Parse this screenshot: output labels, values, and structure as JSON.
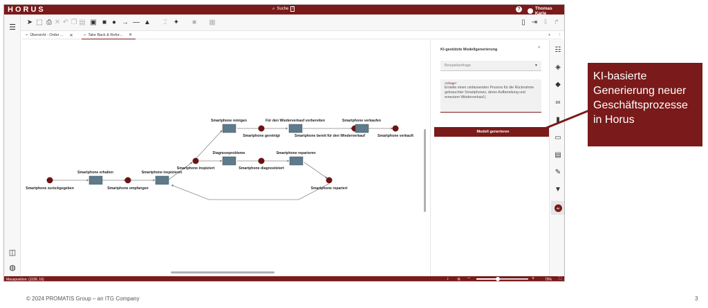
{
  "app": {
    "logo": "HORUS",
    "search_label": "Suche",
    "search_shortcut": "/",
    "user_name": "Thomas Karle",
    "help_label": "?"
  },
  "tabs": [
    {
      "label": "Übersicht - Order ...",
      "close": "✕"
    },
    {
      "label": "Take Back & Refur...",
      "close": "✕"
    }
  ],
  "tab_actions": {
    "add": "+",
    "more": "⋮"
  },
  "toolbar_icons": [
    "select-icon",
    "lasso-icon",
    "lock-icon",
    "print-icon",
    "delete-icon",
    "undo-icon",
    "redo-icon",
    "copy-icon",
    "paste-icon",
    "image-icon",
    "rectangle-icon",
    "circle-icon",
    "arrow-icon",
    "line-icon",
    "shapes-icon",
    "format-icon",
    "magic-icon",
    "color-icon",
    "style-icon",
    "document-icon",
    "auto-layout-icon",
    "export-icon",
    "share-icon"
  ],
  "diagram": {
    "events": [
      "Smartphone zurückgegeben",
      "Smartphone empfangen",
      "Smartphone inspiziert",
      "Smartphone gereinigt",
      "Smartphone bereit für den Wiederverkauf",
      "Smartphone verkauft",
      "Smartphone diagnostiziert",
      "Smartphone repariert"
    ],
    "activities": [
      "Smartphone erhalten",
      "Smartphone inspizieren",
      "Smartphone reinigen",
      "Für den Wiederverkauf vorbereiten",
      "Smartphone verkaufen",
      "Diagnoseprobleme",
      "Smartphone reparieren"
    ]
  },
  "panel": {
    "title": "KI-gestützte Modellgenerierung",
    "collapse_icon": "^",
    "example_placeholder": "Beispielanfrage",
    "request_label": "Anfrage*",
    "request_text": "Erstelle einen umfassenden Prozess für die Rücknahme gebrauchter Smartphones, deren Aufbereitung und erneutem Wiederverkauf.|",
    "generate_label": "Modell generieren"
  },
  "right_rail_icons": [
    "filter-settings-icon",
    "paint-bucket-icon",
    "tag-icon",
    "link-icon",
    "document-icon",
    "text-field-icon",
    "clipboard-icon",
    "edit-document-icon",
    "funnel-icon",
    "ai-icon"
  ],
  "right_rail_ai_label": "AI",
  "status": {
    "mouse_position": "Mausposition: (1199, 16)",
    "zoom_value": "79%",
    "zoom_fraction": 0.41,
    "zoom_minus": "−",
    "zoom_plus": "+"
  },
  "callout": {
    "text": "KI-basierte Generierung neuer Geschäftsprozesse in Horus"
  },
  "footer": {
    "copyright": "© 2024 PROMATIS Group – an ITG Company",
    "page_number": "3"
  },
  "colors": {
    "brand": "#7a1a1a",
    "event": "#6b1313",
    "activity": "#5f7a8a"
  }
}
